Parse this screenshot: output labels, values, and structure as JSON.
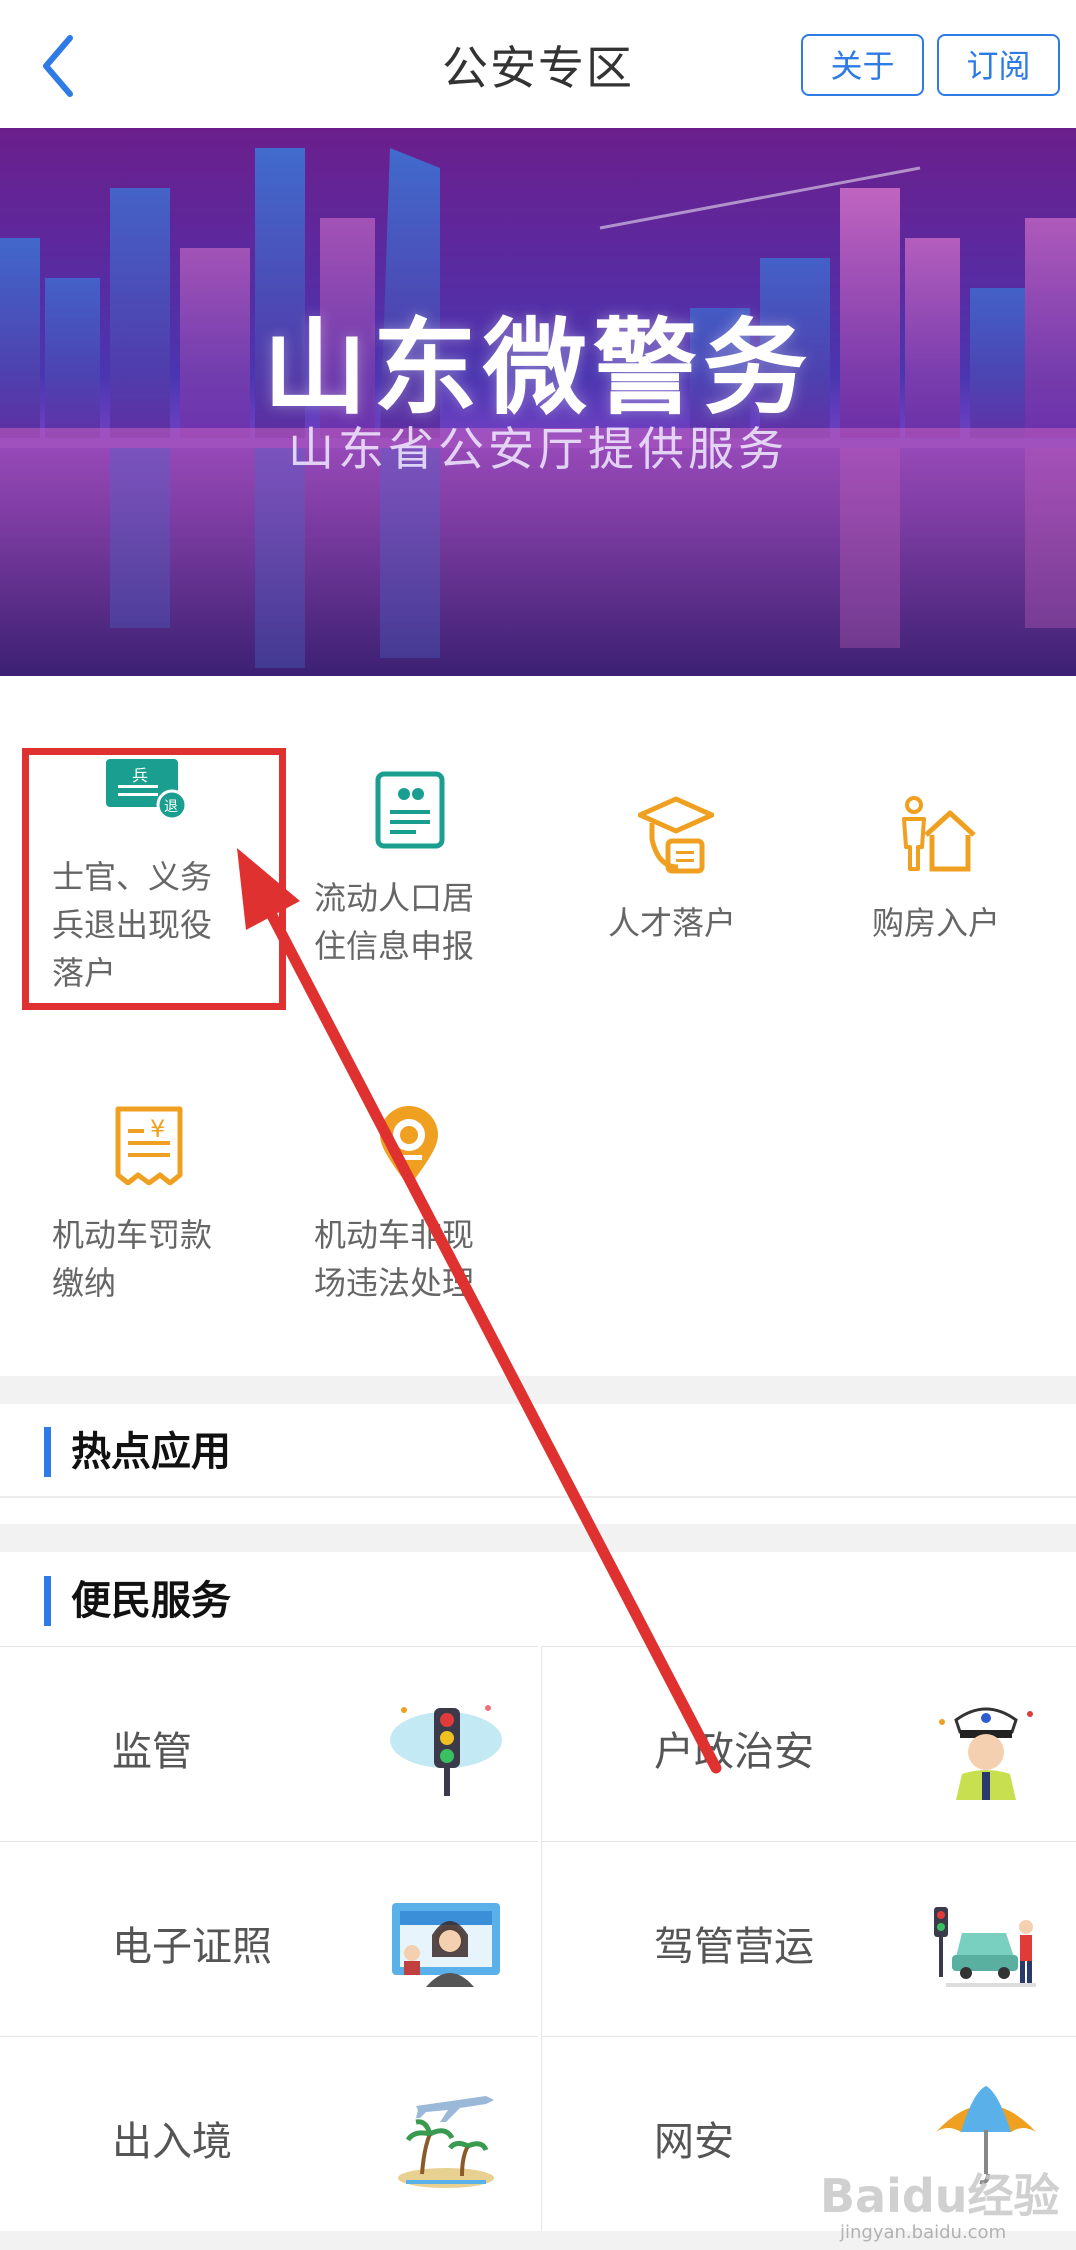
{
  "header": {
    "title": "公安专区",
    "about_label": "关于",
    "subscribe_label": "订阅"
  },
  "banner": {
    "title": "山东微警务",
    "subtitle": "山东省公安厅提供服务"
  },
  "services": [
    {
      "line1": "士官、义务",
      "line2": "兵退出现役",
      "line3": "落户",
      "icon": "veteran-card-icon",
      "icon_text": "兵",
      "icon_badge": "退"
    },
    {
      "line1": "流动人口居",
      "line2": "住信息申报",
      "icon": "resident-info-icon"
    },
    {
      "line1": "人才落户",
      "icon": "graduation-cap-icon"
    },
    {
      "line1": "购房入户",
      "icon": "house-person-icon"
    },
    {
      "line1": "机动车罚款",
      "line2": "缴纳",
      "icon": "receipt-yuan-icon"
    },
    {
      "line1": "机动车非现",
      "line2": "场违法处理",
      "icon": "camera-pin-icon"
    }
  ],
  "sections": {
    "hot_apps": "热点应用",
    "convenience": "便民服务"
  },
  "convenience": [
    {
      "label": "监管",
      "icon": "traffic-light-icon"
    },
    {
      "label": "户政治安",
      "icon": "police-officer-icon"
    },
    {
      "label": "电子证照",
      "icon": "id-photo-icon"
    },
    {
      "label": "驾管营运",
      "icon": "driving-crossing-icon"
    },
    {
      "label": "出入境",
      "icon": "airplane-island-icon"
    },
    {
      "label": "网安",
      "icon": "umbrella-icon"
    }
  ],
  "watermark": {
    "text": "Baidu经验",
    "sub": "jingyan.baidu.com"
  },
  "colors": {
    "accent": "#2e7be5",
    "highlight": "#e03131",
    "icon_teal": "#1a9e8f",
    "icon_orange": "#f0a020"
  }
}
